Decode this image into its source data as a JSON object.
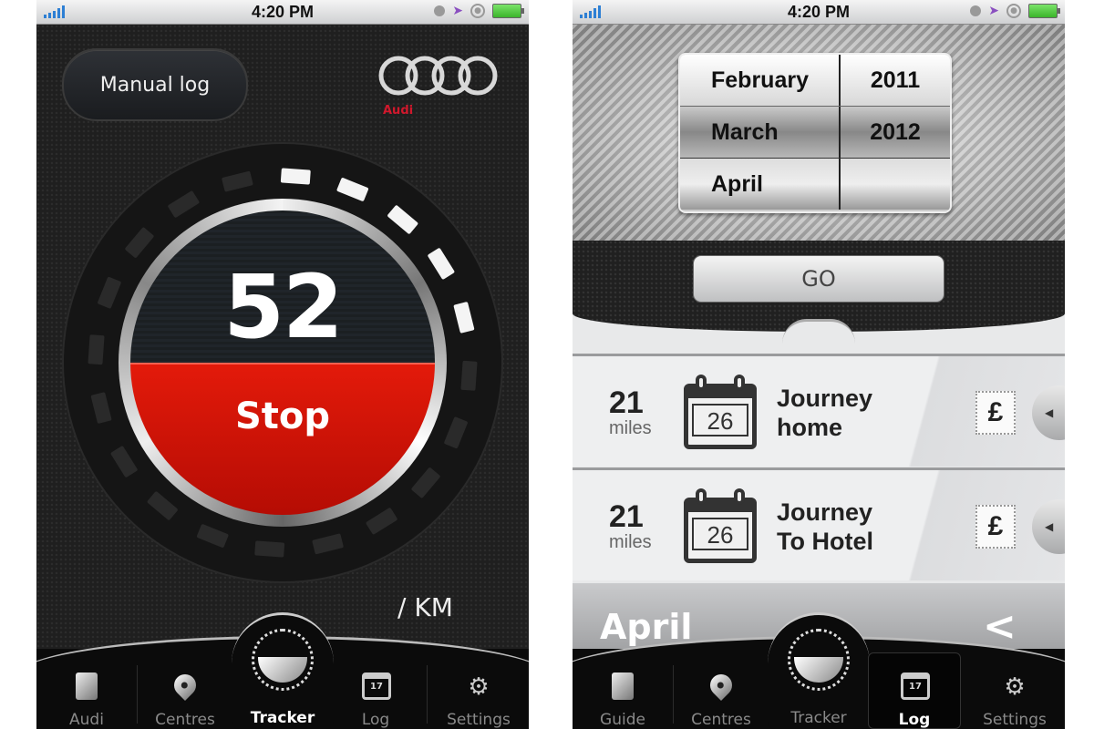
{
  "status_bar": {
    "time": "4:20 PM"
  },
  "tracker_screen": {
    "manual_log_label": "Manual log",
    "brand": "Audi",
    "speed_value": "52",
    "stop_label": "Stop",
    "unit_label": "/ KM",
    "gauge_level": {
      "lit_segments": 5,
      "total_segments": 20
    },
    "accent_color": "#e31a0a",
    "tabs": [
      {
        "label": "Audi",
        "icon": "document-icon"
      },
      {
        "label": "Centres",
        "icon": "map-pin-icon"
      },
      {
        "label": "Tracker",
        "icon": "tracker-icon",
        "active": true
      },
      {
        "label": "Log",
        "icon": "calendar-icon",
        "icon_text": "17"
      },
      {
        "label": "Settings",
        "icon": "gear-icon"
      }
    ]
  },
  "log_screen": {
    "picker": {
      "rows": [
        {
          "month": "February",
          "year": "2011"
        },
        {
          "month": "March",
          "year": "2012"
        },
        {
          "month": "April",
          "year": ""
        }
      ],
      "selected": {
        "month": "March",
        "year": "2012"
      }
    },
    "go_label": "GO",
    "journeys": [
      {
        "miles": "21",
        "unit": "miles",
        "day": "26",
        "title_line1": "Journey",
        "title_line2": "home",
        "currency": "£"
      },
      {
        "miles": "21",
        "unit": "miles",
        "day": "26",
        "title_line1": "Journey",
        "title_line2": "To Hotel",
        "currency": "£"
      }
    ],
    "month_title": "April",
    "back_icon": "chevron-left-icon",
    "tabs": [
      {
        "label": "Guide",
        "icon": "document-icon"
      },
      {
        "label": "Centres",
        "icon": "map-pin-icon"
      },
      {
        "label": "Tracker",
        "icon": "tracker-icon"
      },
      {
        "label": "Log",
        "icon": "calendar-icon",
        "icon_text": "17",
        "active": true
      },
      {
        "label": "Settings",
        "icon": "gear-icon"
      }
    ]
  }
}
